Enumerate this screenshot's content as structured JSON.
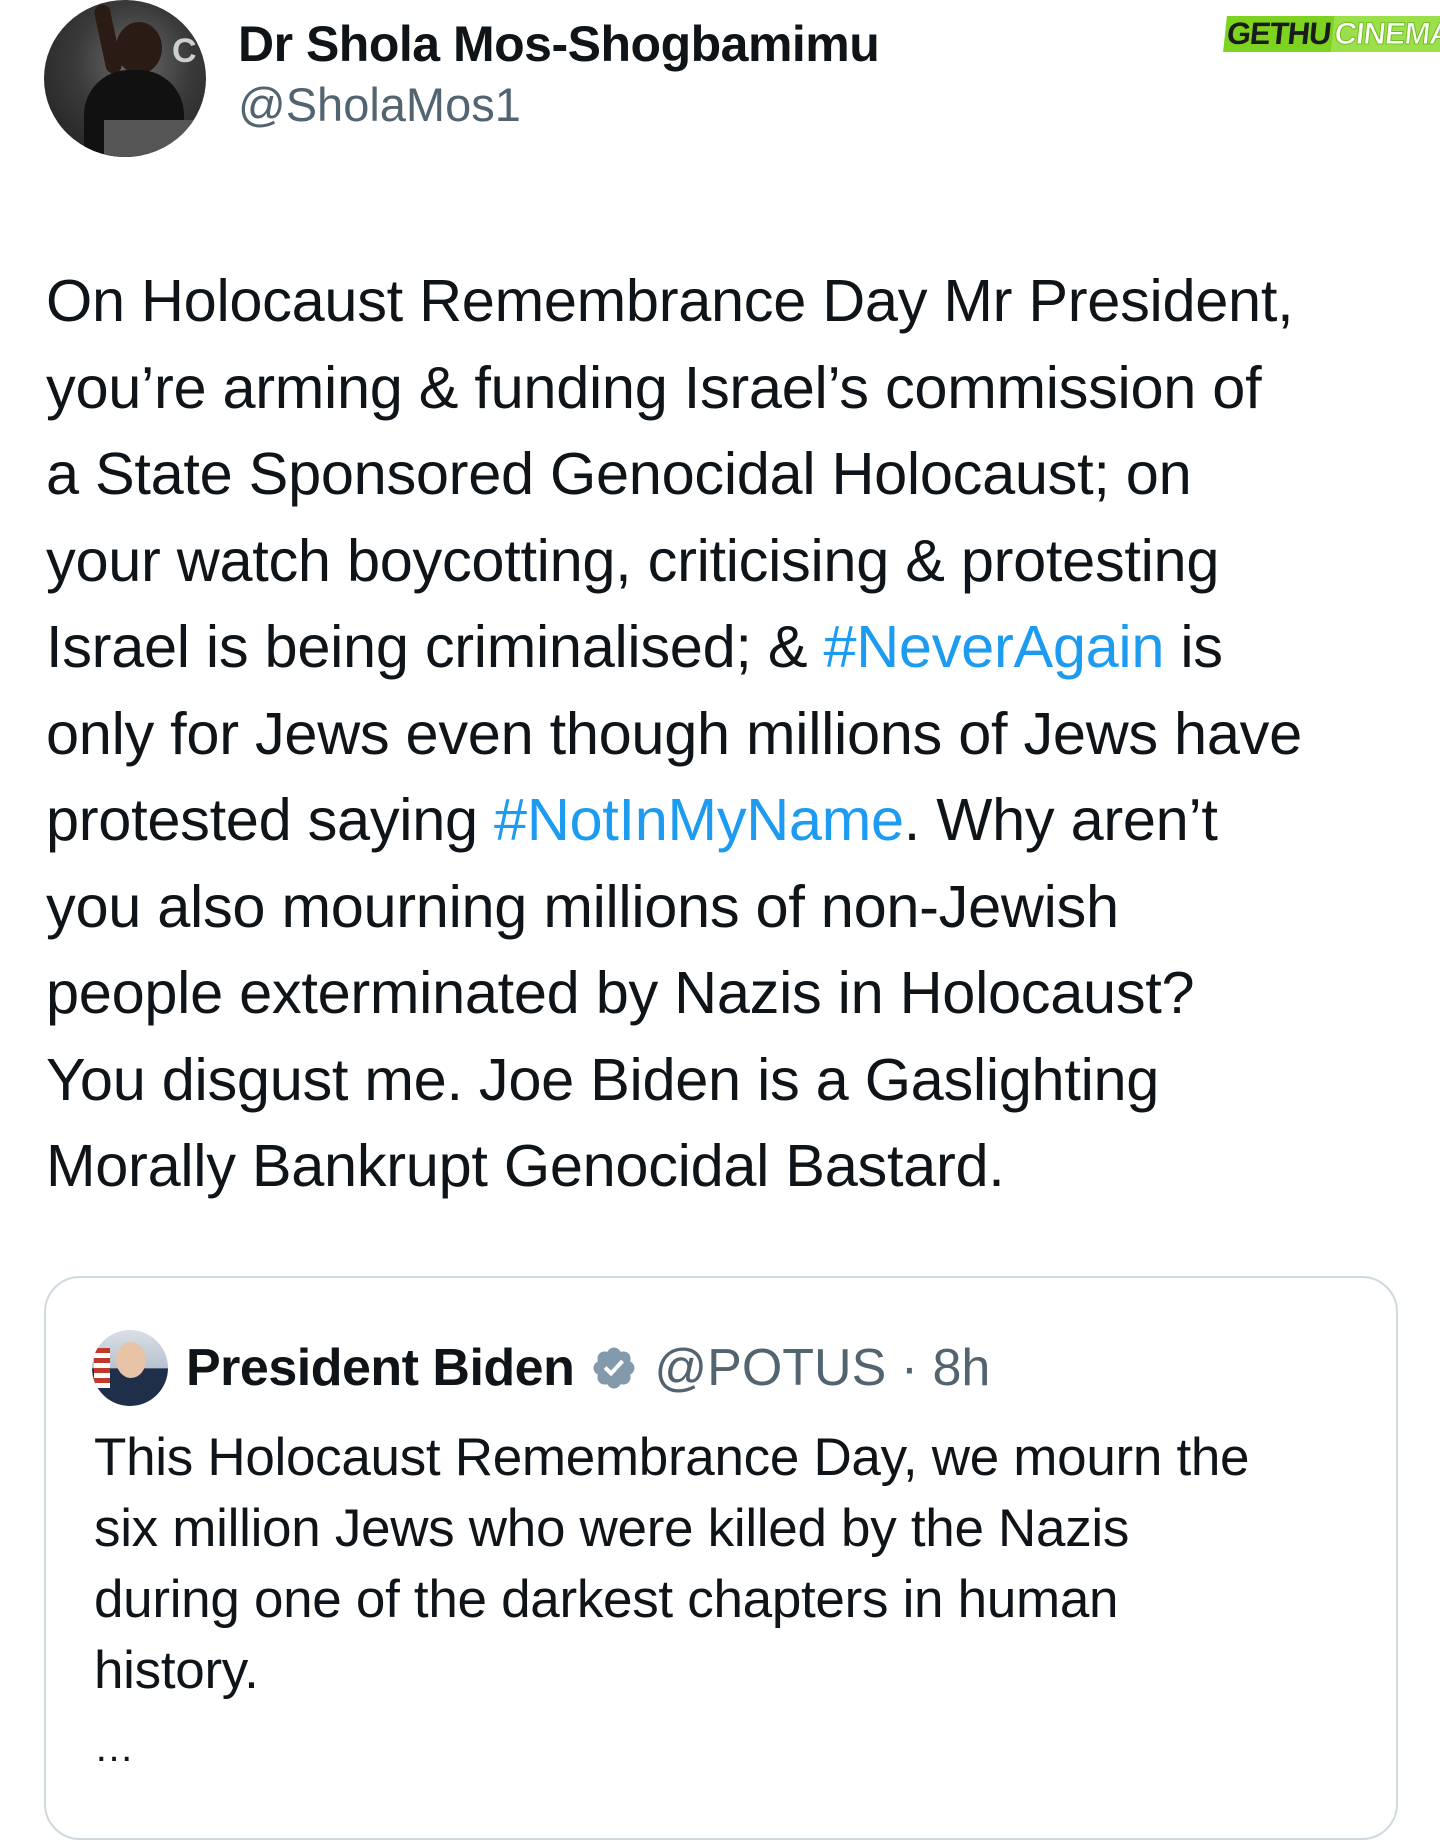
{
  "watermark": {
    "part1": "GETHU",
    "part2": "CINEMA"
  },
  "tweet": {
    "author_name": "Dr Shola Mos-Shogbamimu",
    "author_handle": "@SholaMos1",
    "avatar_sign": "C",
    "text_part1": "On Holocaust Remembrance Day Mr President,\nyou’re arming & funding Israel’s commission of\na State Sponsored Genocidal Holocaust; on\nyour watch boycotting, criticising & protesting\nIsrael is being criminalised; & ",
    "hashtag1": "#NeverAgain",
    "text_part2": " is\nonly for Jews even though millions of Jews have\nprotested saying ",
    "hashtag2": "#NotInMyName",
    "text_part3": ". Why aren’t\nyou also mourning millions of non-Jewish\npeople exterminated by Nazis in Holocaust?\nYou disgust me. Joe Biden is a Gaslighting\nMorally Bankrupt Genocidal Bastard.",
    "link_color": "#1d9bf0"
  },
  "quoted_tweet": {
    "author_name": "President Biden",
    "author_handle_time": "@POTUS · 8h",
    "verified_badge": "verified-badge-icon",
    "text": "This Holocaust Remembrance Day, we mourn the\nsix million Jews who were killed by the Nazis\nduring one of the darkest chapters in human\nhistory.",
    "more": "…"
  }
}
